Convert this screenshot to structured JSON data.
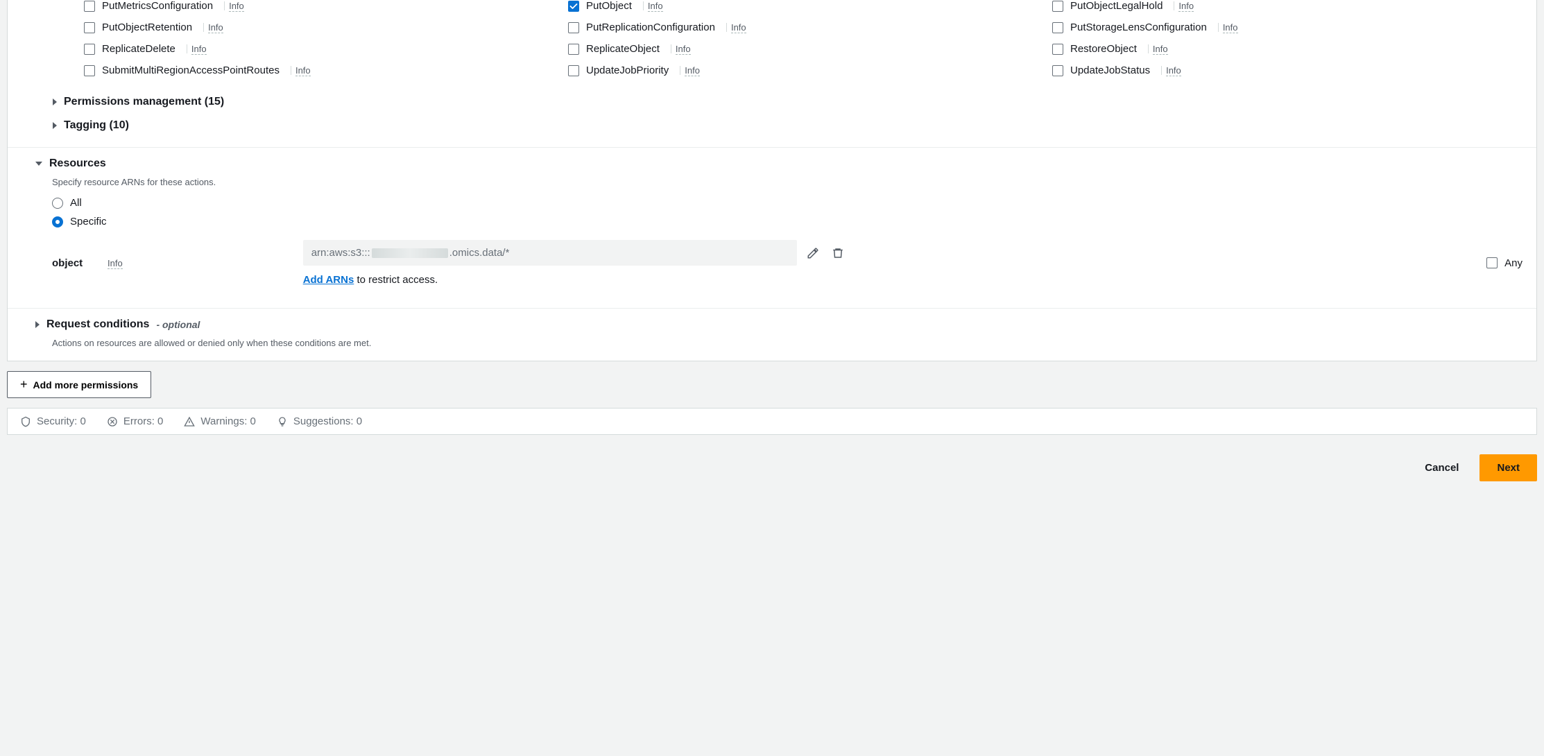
{
  "infoLabel": "Info",
  "actions": [
    {
      "label": "PutMetricsConfiguration",
      "checked": false
    },
    {
      "label": "PutObject",
      "checked": true
    },
    {
      "label": "PutObjectLegalHold",
      "checked": false
    },
    {
      "label": "PutObjectRetention",
      "checked": false
    },
    {
      "label": "PutReplicationConfiguration",
      "checked": false
    },
    {
      "label": "PutStorageLensConfiguration",
      "checked": false
    },
    {
      "label": "ReplicateDelete",
      "checked": false
    },
    {
      "label": "ReplicateObject",
      "checked": false
    },
    {
      "label": "RestoreObject",
      "checked": false
    },
    {
      "label": "SubmitMultiRegionAccessPointRoutes",
      "checked": false
    },
    {
      "label": "UpdateJobPriority",
      "checked": false
    },
    {
      "label": "UpdateJobStatus",
      "checked": false
    }
  ],
  "expanders": {
    "permMgmt": "Permissions management (15)",
    "tagging": "Tagging (10)"
  },
  "resources": {
    "title": "Resources",
    "subtitle": "Specify resource ARNs for these actions.",
    "radios": {
      "all": "All",
      "specific": "Specific"
    },
    "objectLabel": "object",
    "arnPrefix": "arn:aws:s3:::",
    "arnSuffix": ".omics.data/*",
    "addArnsLink": "Add ARNs",
    "addArnsTail": " to restrict access.",
    "anyLabel": "Any"
  },
  "conditions": {
    "title": "Request conditions",
    "optional": "- optional",
    "subtitle": "Actions on resources are allowed or denied only when these conditions are met."
  },
  "addMorePerms": "Add more permissions",
  "stats": {
    "security": "Security: 0",
    "errors": "Errors: 0",
    "warnings": "Warnings: 0",
    "suggestions": "Suggestions: 0"
  },
  "footer": {
    "cancel": "Cancel",
    "next": "Next"
  }
}
